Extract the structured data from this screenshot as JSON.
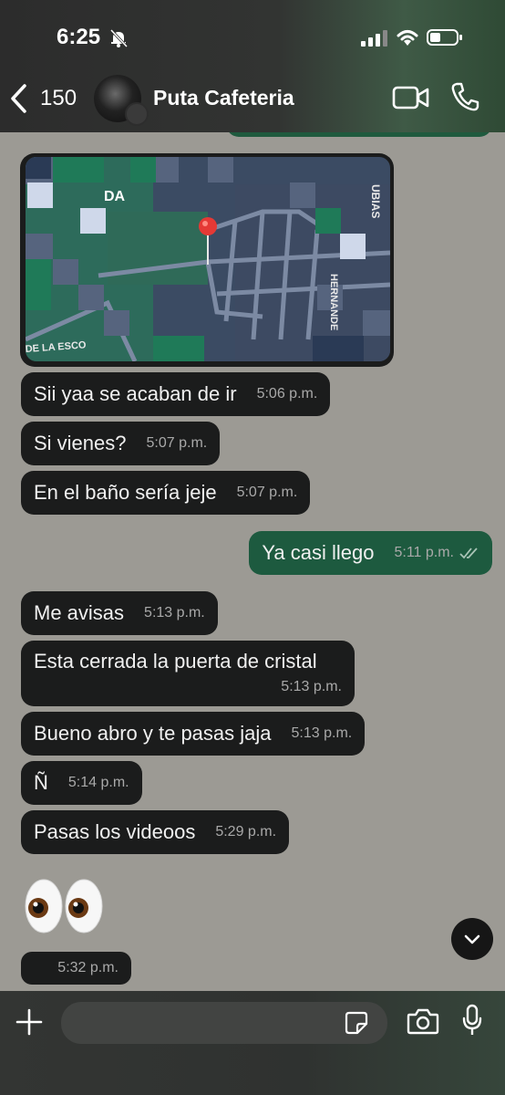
{
  "status_bar": {
    "time": "6:25"
  },
  "header": {
    "back_count": "150",
    "title": "Puta Cafeteria"
  },
  "messages": [
    {
      "text": "Sii yaa se acaban de ir",
      "time": "5:06 p.m."
    },
    {
      "text": "Si vienes?",
      "time": "5:07 p.m."
    },
    {
      "text": "En el baño sería jeje",
      "time": "5:07 p.m."
    },
    {
      "text": "Ya casi llego",
      "time": "5:11 p.m."
    },
    {
      "text": "Me avisas",
      "time": "5:13 p.m."
    },
    {
      "text": "Esta cerrada la puerta de cristal",
      "time": "5:13 p.m."
    },
    {
      "text": "Bueno abro y te pasas jaja",
      "time": "5:13 p.m."
    },
    {
      "text": "Ñ",
      "time": "5:14 p.m."
    },
    {
      "text": "Pasas los videoos",
      "time": "5:29 p.m."
    }
  ],
  "emoji_message": {
    "time": "5:32 p.m."
  },
  "map": {
    "labels": [
      "DA",
      "UBIAS",
      "HERNANDE",
      "DE LA ESCO"
    ]
  },
  "colors": {
    "incoming_bubble": "#1b1c1c",
    "outgoing_bubble": "#1d5a3f",
    "wallpaper": "#9c9a94"
  },
  "icons": [
    "bell-slash-icon",
    "signal-icon",
    "wifi-icon",
    "battery-icon",
    "back-chevron-icon",
    "video-call-icon",
    "phone-icon",
    "chevron-down-icon",
    "plus-icon",
    "sticker-icon",
    "camera-icon",
    "mic-icon",
    "read-receipt-icon",
    "map-pin-icon",
    "eyes-emoji"
  ]
}
